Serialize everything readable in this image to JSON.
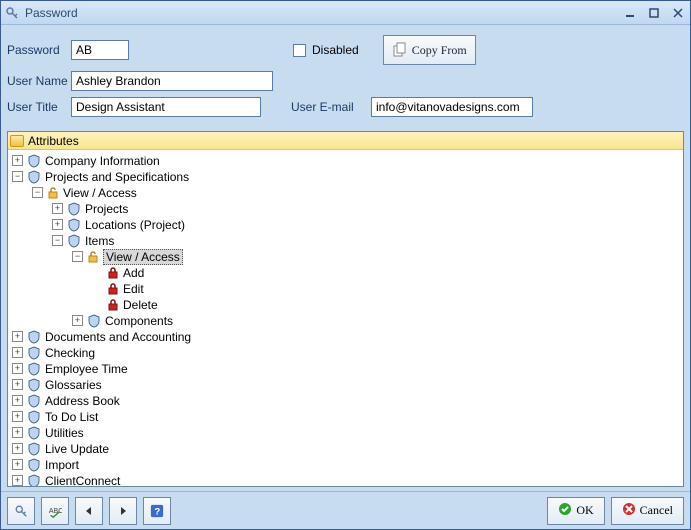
{
  "window": {
    "title": "Password"
  },
  "form": {
    "password_label": "Password",
    "password_value": "AB",
    "username_label": "User Name",
    "username_value": "Ashley Brandon",
    "usertitle_label": "User Title",
    "usertitle_value": "Design Assistant",
    "email_label": "User E-mail",
    "email_value": "info@vitanovadesigns.com",
    "disabled_label": "Disabled",
    "copyfrom_label": "Copy From"
  },
  "tree": {
    "root": "Attributes",
    "n1": "Company Information",
    "n2": "Projects and Specifications",
    "n2a": "View / Access",
    "n2a1": "Projects",
    "n2a2": "Locations (Project)",
    "n2a3": "Items",
    "n2a3a": "View / Access",
    "n2a3a1": "Add",
    "n2a3a2": "Edit",
    "n2a3a3": "Delete",
    "n2a3b": "Components",
    "n3": "Documents and Accounting",
    "n4": "Checking",
    "n5": "Employee Time",
    "n6": "Glossaries",
    "n7": "Address Book",
    "n8": "To Do List",
    "n9": "Utilities",
    "n10": "Live Update",
    "n11": "Import",
    "n12": "ClientConnect"
  },
  "footer": {
    "ok": "OK",
    "cancel": "Cancel"
  }
}
